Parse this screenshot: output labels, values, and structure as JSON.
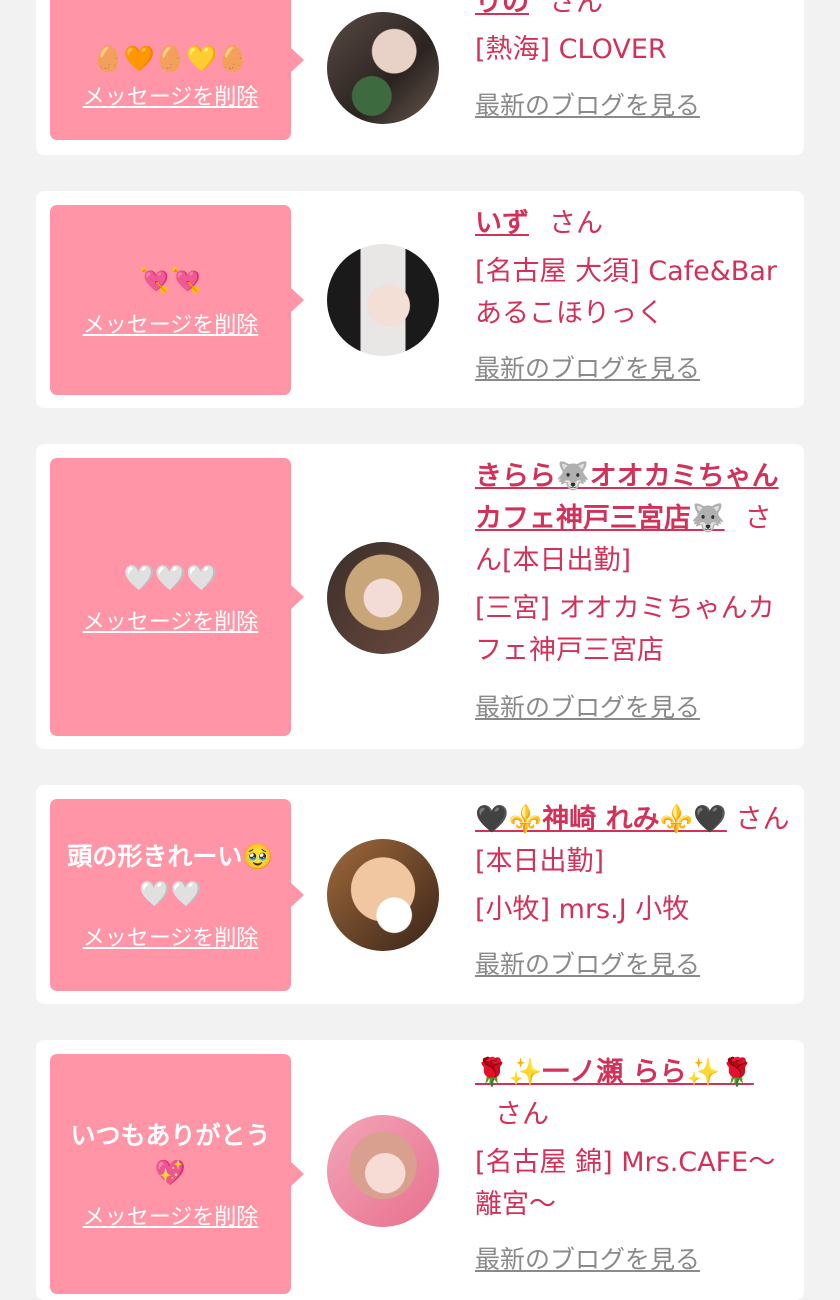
{
  "delete_label": "メッセージを削除",
  "blog_label": "最新のブログを見る",
  "san_label": "さん",
  "cards": [
    {
      "message": "🥚🧡🥚💛🥚",
      "name": "りの",
      "status": "",
      "shop": "[熱海] CLOVER"
    },
    {
      "message": "💘💘",
      "name": "いず",
      "status": "",
      "shop": "[名古屋 大須] Cafe&Bar あるこほりっく"
    },
    {
      "message": "🤍🤍🤍",
      "name": "きらら🐺オオカミちゃんカフェ神戸三宮店🐺",
      "status": "[本日出勤]",
      "shop": "[三宮] オオカミちゃんカフェ神戸三宮店"
    },
    {
      "message": "頭の形きれーい🥹🤍🤍",
      "name": "🖤⚜️神崎 れみ⚜️🖤",
      "status": "[本日出勤]",
      "shop": "[小牧] mrs.J 小牧"
    },
    {
      "message": "いつもありがとう💖",
      "name": "🌹✨一ノ瀬 らら✨🌹",
      "status": "",
      "shop": "[名古屋 錦] Mrs.CAFE〜離宮〜"
    }
  ]
}
